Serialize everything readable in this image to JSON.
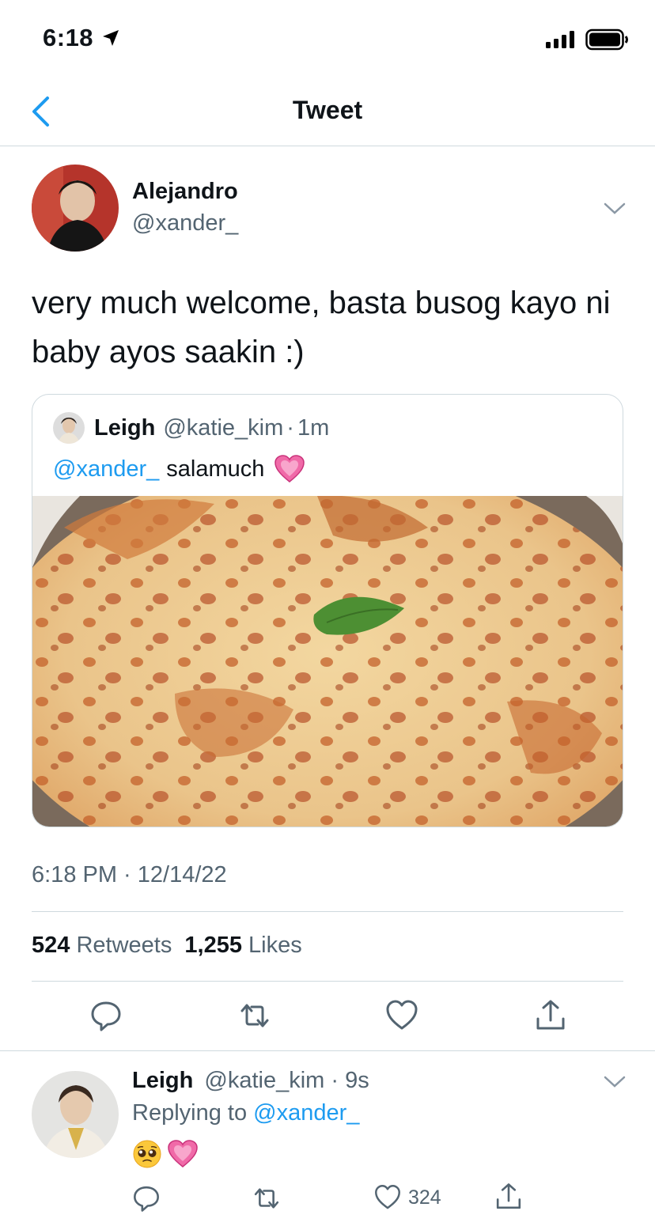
{
  "status_bar": {
    "time": "6:18"
  },
  "nav": {
    "title": "Tweet"
  },
  "tweet": {
    "author_name": "Alejandro",
    "author_handle": "@xander_",
    "text": "very much welcome, basta busog kayo ni baby ayos saakin :)",
    "quote": {
      "author_name": "Leigh",
      "author_handle": "@katie_kim",
      "separator": "·",
      "time_ago": "1m",
      "mention": "@xander_",
      "text": "salamuch"
    },
    "timestamp": "6:18 PM · 12/14/22",
    "retweets_count": "524",
    "retweets_label": "Retweets",
    "likes_count": "1,255",
    "likes_label": "Likes"
  },
  "reply": {
    "author_name": "Leigh",
    "author_handle": "@katie_kim",
    "separator": "·",
    "time_ago": "9s",
    "replying_to_label": "Replying to",
    "replying_to_handle": "@xander_",
    "likes_count": "324"
  },
  "icons": [
    "back-chevron-icon",
    "location-arrow-icon",
    "signal-icon",
    "battery-icon",
    "chevron-down-icon",
    "reply-icon",
    "retweet-icon",
    "like-icon",
    "share-icon",
    "pleading-face-emoji",
    "growing-heart-emoji"
  ],
  "colors": {
    "link": "#1d9bf0",
    "secondary_text": "#536471",
    "divider": "#cfd9de"
  }
}
